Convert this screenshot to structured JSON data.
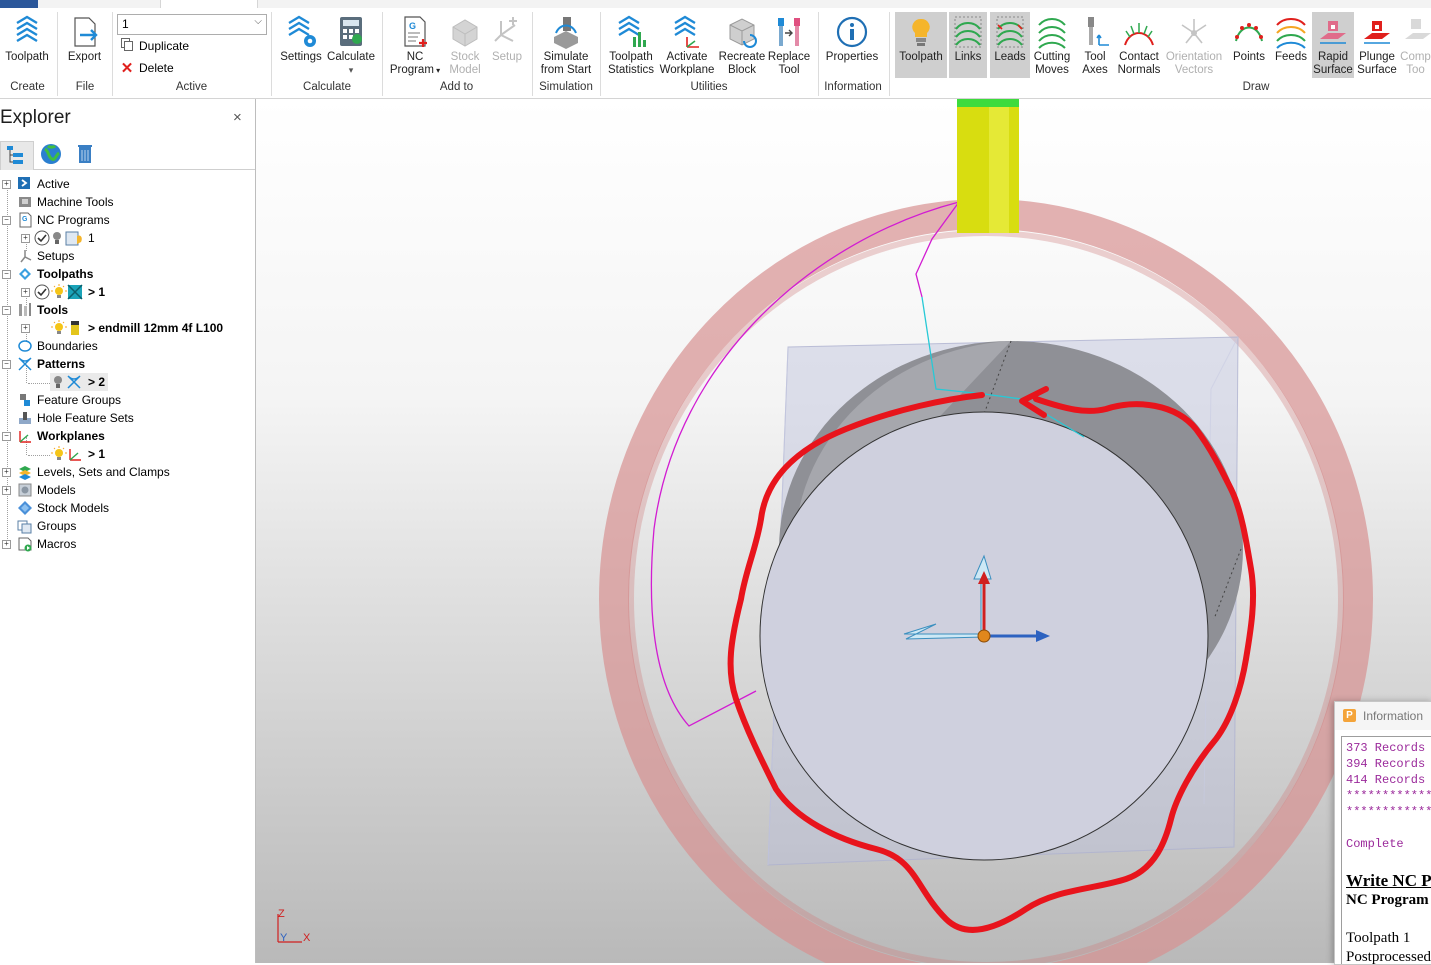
{
  "ribbon": {
    "create": {
      "toolpath_label": "Toolpath",
      "group_label": "Create"
    },
    "file": {
      "export_label": "Export",
      "group_label": "File"
    },
    "active": {
      "selected_value": "1",
      "duplicate_label": "Duplicate",
      "delete_label": "Delete",
      "group_label": "Active"
    },
    "calculate": {
      "settings_label": "Settings",
      "calculate_label": "Calculate",
      "group_label": "Calculate"
    },
    "add_to": {
      "nc_program_label": "NC",
      "nc_program_label2": "Program",
      "stock_model_label": "Stock",
      "stock_model_label2": "Model",
      "setup_label": "Setup",
      "group_label": "Add to"
    },
    "simulation": {
      "simulate_label": "Simulate",
      "simulate_label2": "from Start",
      "group_label": "Simulation"
    },
    "utilities": {
      "toolpath_statistics_label": "Toolpath",
      "toolpath_statistics_label2": "Statistics",
      "activate_workplane_label": "Activate",
      "activate_workplane_label2": "Workplane",
      "recreate_block_label": "Recreate",
      "recreate_block_label2": "Block",
      "replace_tool_label": "Replace",
      "replace_tool_label2": "Tool",
      "group_label": "Utilities"
    },
    "information": {
      "properties_label": "Properties",
      "group_label": "Information"
    },
    "draw": {
      "toolpath_label": "Toolpath",
      "links_label": "Links",
      "leads_label": "Leads",
      "cutting_moves_label": "Cutting",
      "cutting_moves_label2": "Moves",
      "tool_axes_label": "Tool",
      "tool_axes_label2": "Axes",
      "contact_normals_label": "Contact",
      "contact_normals_label2": "Normals",
      "orientation_vectors_label": "Orientation",
      "orientation_vectors_label2": "Vectors",
      "points_label": "Points",
      "feeds_label": "Feeds",
      "rapid_surface_label": "Rapid",
      "rapid_surface_label2": "Surface",
      "plunge_surface_label": "Plunge",
      "plunge_surface_label2": "Surface",
      "comp_label": "Comp",
      "comp_label2": "Too",
      "group_label": "Draw"
    }
  },
  "explorer": {
    "title": "Explorer",
    "close_glyph": "×",
    "items": [
      {
        "label": "Active",
        "bold": false
      },
      {
        "label": "Machine Tools",
        "bold": false
      },
      {
        "label": "NC Programs",
        "bold": false
      },
      {
        "label": "1",
        "bold": false
      },
      {
        "label": "Setups",
        "bold": false
      },
      {
        "label": "Toolpaths",
        "bold": true
      },
      {
        "label": "> 1",
        "bold": true
      },
      {
        "label": "Tools",
        "bold": true
      },
      {
        "label": "> endmill 12mm 4f L100",
        "bold": true
      },
      {
        "label": "Boundaries",
        "bold": false
      },
      {
        "label": "Patterns",
        "bold": true
      },
      {
        "label": "> 2",
        "bold": true
      },
      {
        "label": "Feature Groups",
        "bold": false
      },
      {
        "label": "Hole Feature Sets",
        "bold": false
      },
      {
        "label": "Workplanes",
        "bold": true
      },
      {
        "label": "> 1",
        "bold": true
      },
      {
        "label": "Levels, Sets and Clamps",
        "bold": false
      },
      {
        "label": "Models",
        "bold": false
      },
      {
        "label": "Stock Models",
        "bold": false
      },
      {
        "label": "Groups",
        "bold": false
      },
      {
        "label": "Macros",
        "bold": false
      }
    ]
  },
  "viewport": {
    "axis_z": "Z",
    "axis_y": "Y",
    "axis_x": "X",
    "colors": {
      "annotation": "#e8141c",
      "rapid_surface": "#d98a8a",
      "tool_shank": "#d8dd10",
      "tool_holder": "#3ddb3d",
      "toolpath_link": "#d21cd2",
      "lead": "#27c9d6"
    }
  },
  "info_window": {
    "title": "Information",
    "lines": [
      "373 Records",
      "394 Records",
      "414 Records",
      "************",
      "************"
    ],
    "complete": "Complete",
    "heading": "Write NC Pr",
    "subheading": "NC Program",
    "toolpath_line": "Toolpath 1",
    "post_line": "Postprocessed"
  }
}
